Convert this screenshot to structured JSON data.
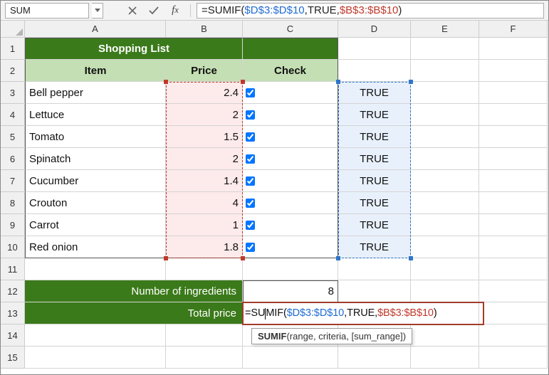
{
  "namebox": "SUM",
  "formula_prefix": "=SUMIF(",
  "formula_range1": "$D$3:$D$10",
  "formula_mid": ",TRUE,",
  "formula_range2": "$B$3:$B$10",
  "formula_suffix": ")",
  "columns": [
    "A",
    "B",
    "C",
    "D",
    "E",
    "F"
  ],
  "rows": [
    "1",
    "2",
    "3",
    "4",
    "5",
    "6",
    "7",
    "8",
    "9",
    "10",
    "11",
    "12",
    "13",
    "14",
    "15"
  ],
  "title": "Shopping List",
  "headers": {
    "item": "Item",
    "price": "Price",
    "check": "Check"
  },
  "items": [
    {
      "name": "Bell pepper",
      "price": "2.4",
      "checked": true,
      "flag": "TRUE"
    },
    {
      "name": "Lettuce",
      "price": "2",
      "checked": true,
      "flag": "TRUE"
    },
    {
      "name": "Tomato",
      "price": "1.5",
      "checked": true,
      "flag": "TRUE"
    },
    {
      "name": "Spinatch",
      "price": "2",
      "checked": true,
      "flag": "TRUE"
    },
    {
      "name": "Cucumber",
      "price": "1.4",
      "checked": true,
      "flag": "TRUE"
    },
    {
      "name": "Crouton",
      "price": "4",
      "checked": true,
      "flag": "TRUE"
    },
    {
      "name": "Carrot",
      "price": "1",
      "checked": true,
      "flag": "TRUE"
    },
    {
      "name": "Red onion",
      "price": "1.8",
      "checked": true,
      "flag": "TRUE"
    }
  ],
  "summary": {
    "num_label": "Number of ingredients",
    "num_value": "8",
    "total_label": "Total price"
  },
  "inline_formula": {
    "pre": "=SU",
    "post1": "MIF(",
    "r1": "$D$3:$D$10",
    "mid": ",TRUE,",
    "r2": "$B$3:$B$10",
    "end": ")"
  },
  "tooltip": {
    "fn": "SUMIF",
    "sig": "(range, criteria, [sum_range])"
  }
}
